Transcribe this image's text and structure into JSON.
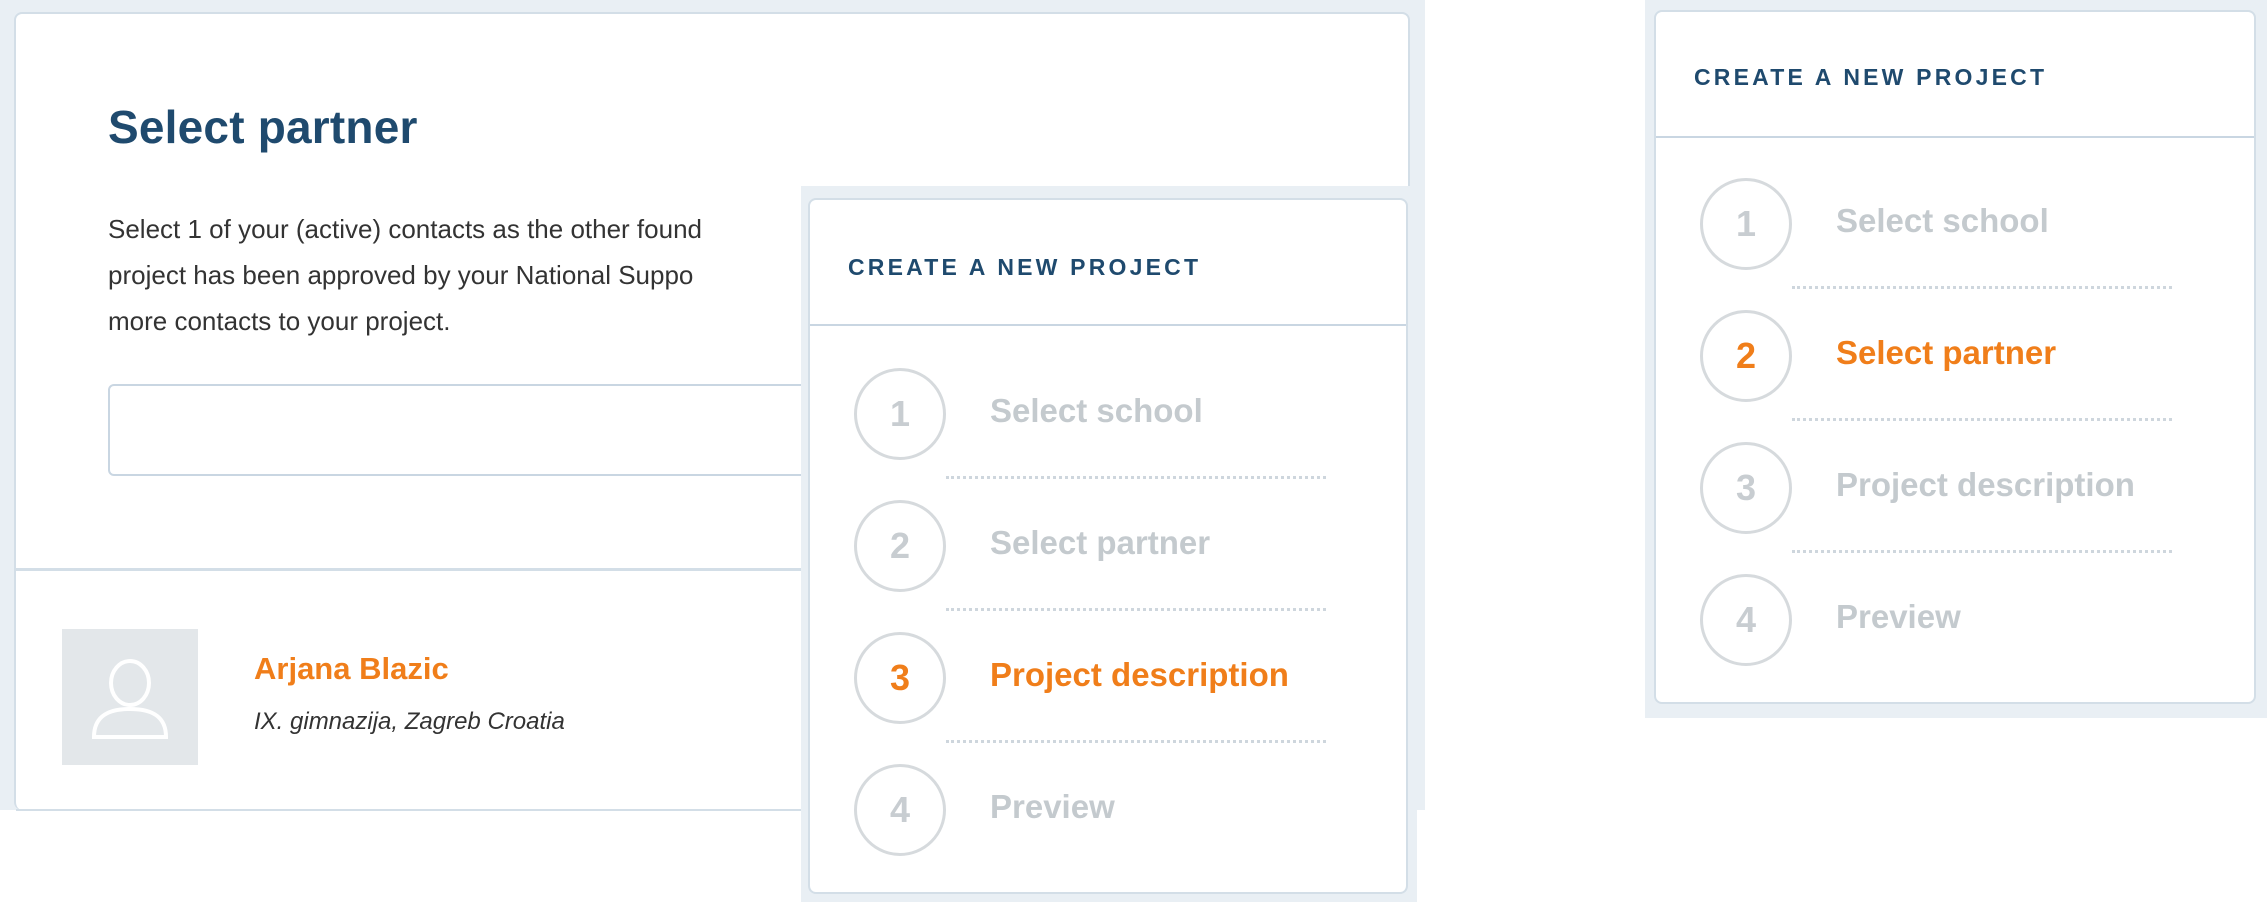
{
  "main": {
    "title": "Select partner",
    "intro_line1": "Select 1 of your (active) contacts as the other found",
    "intro_line2": "project has been approved by your National Suppo",
    "intro_line3": "more contacts to your project.",
    "search": {
      "value": "",
      "placeholder": ""
    },
    "contact": {
      "name": "Arjana Blazic",
      "school": "IX. gimnazija, Zagreb Croatia",
      "avatar_icon": "user-silhouette-icon"
    }
  },
  "stepper_a": {
    "title": "CREATE A NEW PROJECT",
    "active_step": 3,
    "steps": [
      {
        "number": "1",
        "label": "Select school"
      },
      {
        "number": "2",
        "label": "Select partner"
      },
      {
        "number": "3",
        "label": "Project description"
      },
      {
        "number": "4",
        "label": "Preview"
      }
    ]
  },
  "stepper_b": {
    "title": "CREATE A NEW PROJECT",
    "active_step": 2,
    "steps": [
      {
        "number": "1",
        "label": "Select school"
      },
      {
        "number": "2",
        "label": "Select partner"
      },
      {
        "number": "3",
        "label": "Project description"
      },
      {
        "number": "4",
        "label": "Preview"
      }
    ]
  },
  "colors": {
    "heading": "#1f4a6e",
    "accent": "#f07e1a",
    "inactive": "#c4cace",
    "border": "#d3dee7"
  }
}
